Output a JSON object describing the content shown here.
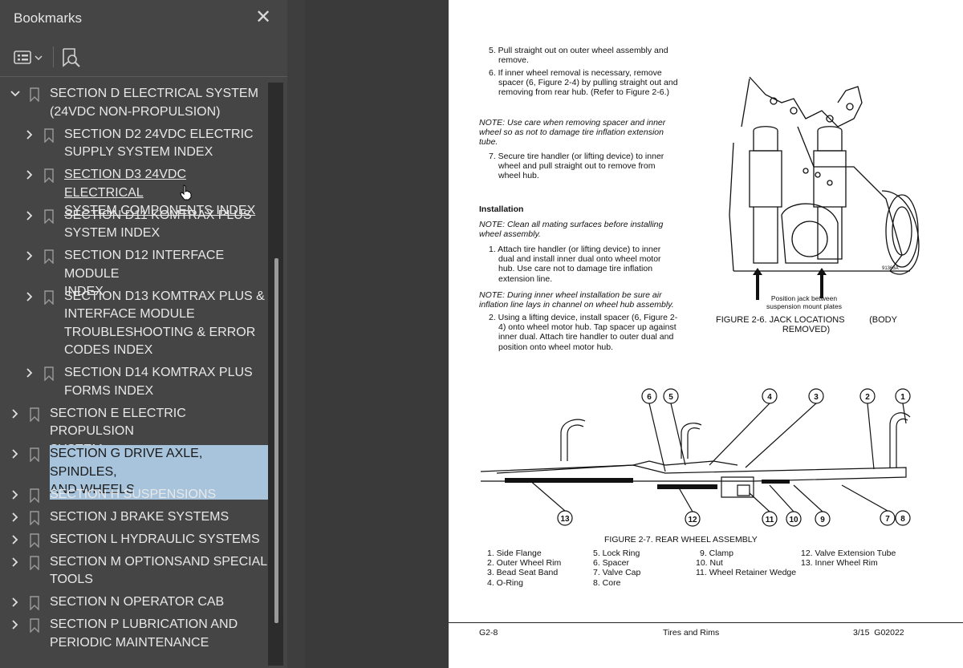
{
  "sidebar": {
    "title": "Bookmarks",
    "close_icon": "close-icon",
    "toolbar": {
      "options_icon": "bookmark-options-icon",
      "find_icon": "find-bookmark-icon"
    },
    "items": [
      {
        "label_lines": [
          "SECTION D ELECTRICAL SYSTEM",
          "(24VDC NON-PROPULSION)"
        ],
        "expanded": true,
        "level": 0
      },
      {
        "label_lines": [
          "SECTION D2 24VDC ELECTRIC",
          "SUPPLY SYSTEM INDEX"
        ],
        "expanded": false,
        "level": 1
      },
      {
        "label_lines": [
          "SECTION D3 24VDC ELECTRICAL",
          "SYSTEM COMPONENTS INDEX"
        ],
        "expanded": false,
        "level": 1,
        "hovered": true
      },
      {
        "label_lines": [
          "SECTION D11 KOMTRAX PLUS",
          "SYSTEM INDEX"
        ],
        "expanded": false,
        "level": 1
      },
      {
        "label_lines": [
          "SECTION D12 INTERFACE MODULE",
          "INDEX"
        ],
        "expanded": false,
        "level": 1
      },
      {
        "label_lines": [
          "SECTION D13 KOMTRAX PLUS &",
          "INTERFACE MODULE",
          "TROUBLESHOOTING & ERROR",
          "CODES INDEX"
        ],
        "expanded": false,
        "level": 1
      },
      {
        "label_lines": [
          "SECTION D14 KOMTRAX PLUS",
          "FORMS INDEX"
        ],
        "expanded": false,
        "level": 1
      },
      {
        "label_lines": [
          "SECTION E ELECTRIC PROPULSION",
          "SYSTEM"
        ],
        "expanded": false,
        "level": 0
      },
      {
        "label_lines": [
          "SECTION G DRIVE AXLE, SPINDLES,",
          "AND WHEELS"
        ],
        "expanded": false,
        "level": 0,
        "selected": true
      },
      {
        "label_lines": [
          "SECTION H SUSPENSIONS"
        ],
        "expanded": false,
        "level": 0
      },
      {
        "label_lines": [
          "SECTION J BRAKE SYSTEMS"
        ],
        "expanded": false,
        "level": 0
      },
      {
        "label_lines": [
          "SECTION L HYDRAULIC SYSTEMS"
        ],
        "expanded": false,
        "level": 0
      },
      {
        "label_lines": [
          "SECTION M OPTIONSAND SPECIAL",
          "TOOLS"
        ],
        "expanded": false,
        "level": 0
      },
      {
        "label_lines": [
          "SECTION N OPERATOR CAB"
        ],
        "expanded": false,
        "level": 0
      },
      {
        "label_lines": [
          "SECTION P LUBRICATION AND",
          "PERIODIC MAINTENANCE"
        ],
        "expanded": false,
        "level": 0
      }
    ]
  },
  "document": {
    "step5": [
      "5.  Pull straight out on outer wheel assembly and",
      "remove."
    ],
    "step6": [
      "6.  If inner wheel removal is necessary, remove",
      "spacer (6, Figure 2-4) by pulling straight out and",
      "removing from rear hub. (Refer to Figure 2-6.)"
    ],
    "note1": [
      "NOTE:  Use care when removing spacer and inner",
      "wheel so as not to damage tire inflation extension",
      "tube."
    ],
    "step7": [
      "7.  Secure tire handler (or lifting device) to inner",
      "wheel and pull straight out to remove from",
      "wheel hub."
    ],
    "installation_heading": "Installation",
    "note2": [
      "NOTE:  Clean all mating surfaces before installing",
      "wheel assembly."
    ],
    "step1": [
      "1.  Attach tire handler (or lifting device) to inner",
      "dual and install inner dual onto wheel motor",
      "hub. Use care not to damage tire inflation",
      "extension line."
    ],
    "note3": [
      "NOTE:  During inner wheel installation be sure air",
      "inflation line lays in channel on wheel hub assembly."
    ],
    "step2": [
      "2.  Using a lifting device, install spacer (6, Figure 2-",
      "4) onto wheel motor hub. Tap spacer up against",
      "inner dual. Attach tire handler to outer dual and",
      "position onto wheel motor hub."
    ],
    "fig6_callout": [
      "Position jack between",
      "suspension mount plates"
    ],
    "fig6_id": "91363A",
    "fig6_caption": [
      "FIGURE 2-6. JACK LOCATIONS          (BODY",
      "REMOVED)"
    ],
    "fig7_callouts": [
      "1",
      "2",
      "3",
      "4",
      "5",
      "6",
      "7",
      "8",
      "9",
      "10",
      "11",
      "12",
      "13"
    ],
    "fig7_caption": "FIGURE 2-7. REAR WHEEL ASSEMBLY",
    "legend_col1": [
      "1. Side Flange",
      "2. Outer Wheel Rim",
      "3. Bead Seat Band",
      "4. O-Ring"
    ],
    "legend_col2": [
      "5. Lock Ring",
      "6. Spacer",
      "7. Valve Cap",
      "8. Core"
    ],
    "legend_col3": [
      "9. Clamp",
      "10. Nut",
      "11. Wheel Retainer Wedge"
    ],
    "legend_col4": [
      "12. Valve Extension Tube",
      "13. Inner Wheel Rim"
    ],
    "footer": {
      "left": "G2-8",
      "center": "Tires and Rims",
      "right": "3/15  G02022"
    }
  }
}
